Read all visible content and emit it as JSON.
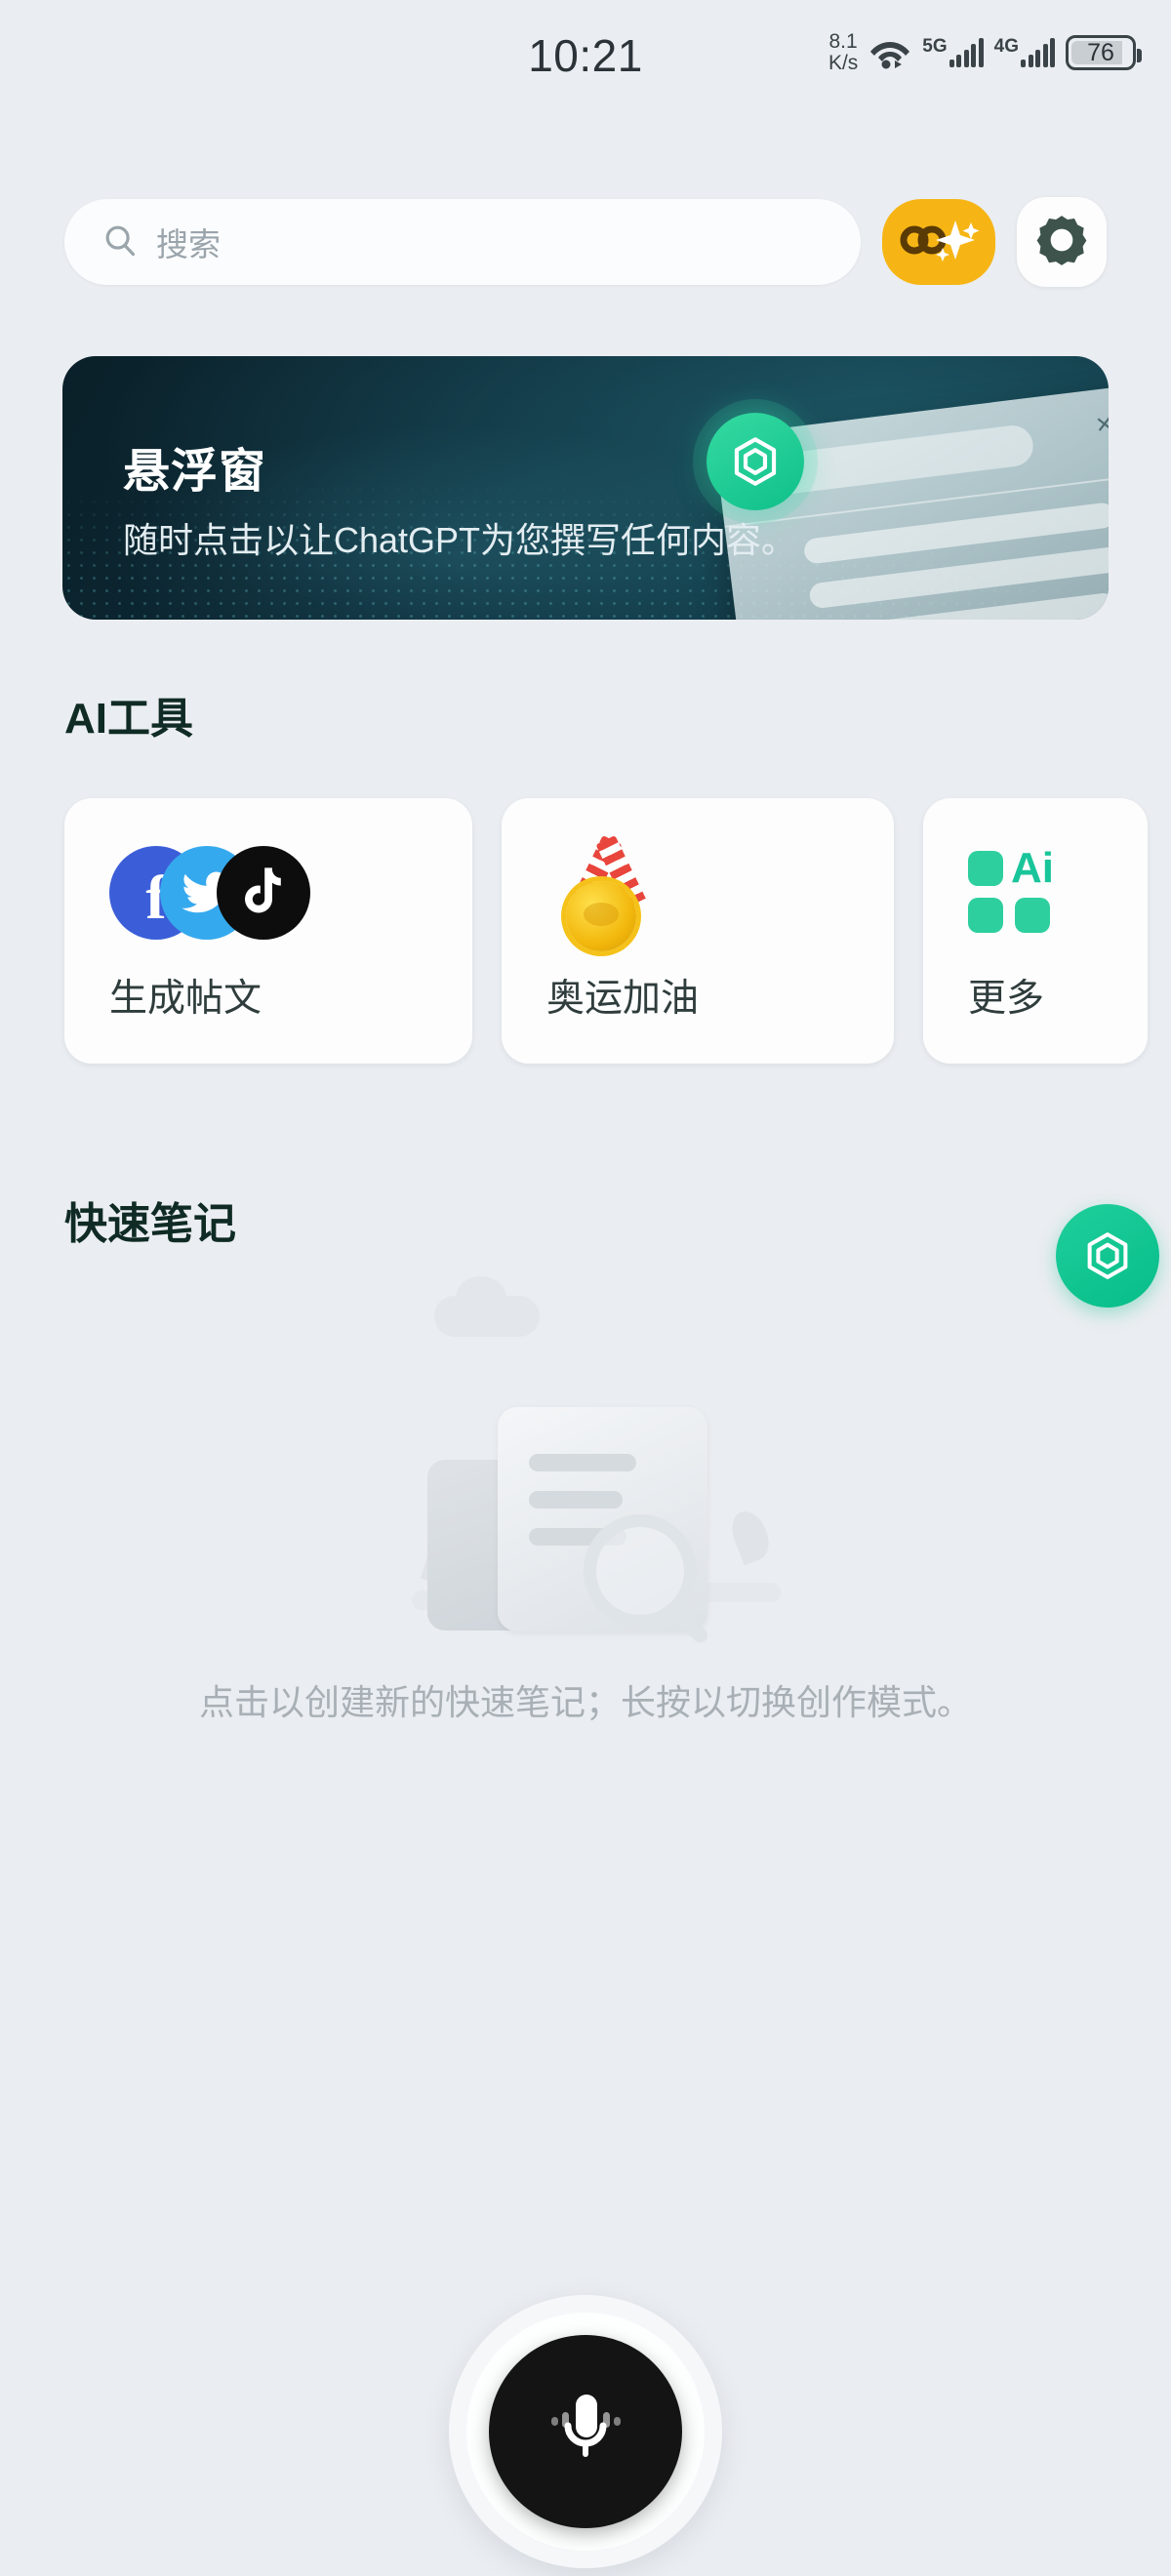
{
  "statusbar": {
    "time": "10:21",
    "net_speed_value": "8.1",
    "net_speed_unit": "K/s",
    "wifi_icon": "wifi-icon",
    "net_label_1": "5G",
    "net_label_2": "4G",
    "battery_level": "76"
  },
  "search": {
    "placeholder": "搜索",
    "icon": "search-icon"
  },
  "toolbar": {
    "assistant_button_icon": "ai-sparkle-icon",
    "settings_button_icon": "gear-icon"
  },
  "banner": {
    "title": "悬浮窗",
    "subtitle": "随时点击以让ChatGPT为您撰写任何内容。",
    "logo_icon": "hexagon-logo-icon",
    "mock_close_icon": "×",
    "bg_color": "#0d2c39",
    "accent_color": "#1fcf9c"
  },
  "sections": {
    "ai_tools_title": "AI工具",
    "quick_notes_title": "快速笔记"
  },
  "ai_tools": [
    {
      "label": "生成帖文",
      "icon": "social-stack-icon"
    },
    {
      "label": "奥运加油",
      "icon": "medal-icon"
    },
    {
      "label": "更多",
      "icon": "ai-grid-icon"
    }
  ],
  "quick_notes": {
    "empty_illustration": "document-search-illustration",
    "empty_text": "点击以创建新的快速笔记；长按以切换创作模式。"
  },
  "fab": {
    "icon": "hexagon-logo-icon",
    "color": "#11c893"
  },
  "mic": {
    "icon": "microphone-icon",
    "color": "#141414"
  }
}
